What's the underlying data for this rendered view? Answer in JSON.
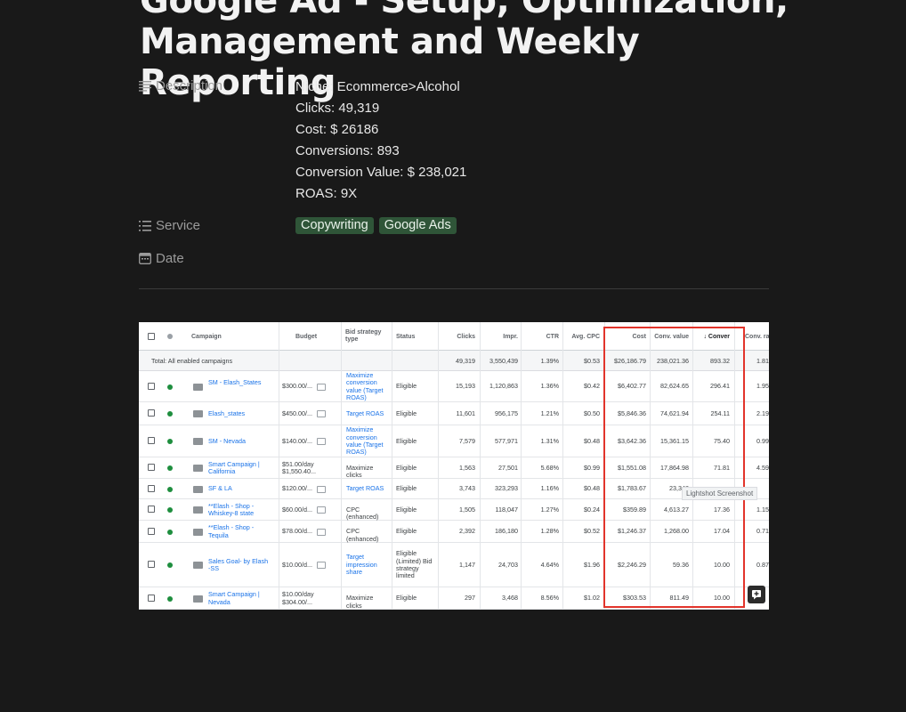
{
  "title": "Google Ad - Setup, Optimization, Management and Weekly Reporting",
  "properties": {
    "description_label": "Description",
    "description_lines": [
      "Niche: Ecommerce>Alcohol",
      "Clicks: 49,319",
      "Cost: $ 26186",
      "Conversions: 893",
      "Conversion Value: $ 238,021",
      "ROAS: 9X"
    ],
    "service_label": "Service",
    "service_tags": [
      "Copywriting",
      "Google Ads"
    ],
    "date_label": "Date",
    "tag_color": "#2f5538"
  },
  "screenshot": {
    "headers": [
      "Campaign",
      "Budget",
      "Bid strategy type",
      "Status",
      "Clicks",
      "Impr.",
      "CTR",
      "Avg. CPC",
      "Cost",
      "Conv. value",
      "↓ Conver",
      "Conv. rat"
    ],
    "total_row": {
      "label": "Total: All enabled campaigns",
      "clicks": "49,319",
      "impr": "3,550,439",
      "ctr": "1.39%",
      "cpc": "$0.53",
      "cost": "$26,186.79",
      "conv_value": "238,021.36",
      "conv": "893.32",
      "conv_rate": "1.81"
    },
    "rows": [
      {
        "campaign": "SM - Elash_States",
        "budget": "$300.00/...",
        "bid": "Maximize conversion value (Target ROAS)",
        "bid_link": true,
        "status": "Eligible",
        "clicks": "15,193",
        "impr": "1,120,863",
        "ctr": "1.36%",
        "cpc": "$0.42",
        "cost": "$6,402.77",
        "conv_value": "82,624.65",
        "conv": "296.41",
        "conv_rate": "1.95"
      },
      {
        "campaign": "Elash_states",
        "budget": "$450.00/...",
        "bid": "Target ROAS",
        "bid_link": true,
        "status": "Eligible",
        "clicks": "11,601",
        "impr": "956,175",
        "ctr": "1.21%",
        "cpc": "$0.50",
        "cost": "$5,846.36",
        "conv_value": "74,621.94",
        "conv": "254.11",
        "conv_rate": "2.19"
      },
      {
        "campaign": "SM - Nevada",
        "budget": "$140.00/...",
        "bid": "Maximize conversion value (Target ROAS)",
        "bid_link": true,
        "status": "Eligible",
        "clicks": "7,579",
        "impr": "577,971",
        "ctr": "1.31%",
        "cpc": "$0.48",
        "cost": "$3,642.36",
        "conv_value": "15,361.15",
        "conv": "75.40",
        "conv_rate": "0.99"
      },
      {
        "campaign": "Smart Campaign | California",
        "budget": "$51.00/day $1,550.40...",
        "bid": "Maximize clicks",
        "bid_link": false,
        "status": "Eligible",
        "clicks": "1,563",
        "impr": "27,501",
        "ctr": "5.68%",
        "cpc": "$0.99",
        "cost": "$1,551.08",
        "conv_value": "17,864.98",
        "conv": "71.81",
        "conv_rate": "4.59"
      },
      {
        "campaign": "SF & LA",
        "budget": "$120.00/...",
        "bid": "Target ROAS",
        "bid_link": true,
        "status": "Eligible",
        "clicks": "3,743",
        "impr": "323,293",
        "ctr": "1.16%",
        "cpc": "$0.48",
        "cost": "$1,783.67",
        "conv_value": "23,348",
        "conv": "",
        "conv_rate": ""
      },
      {
        "campaign": "**Elash - Shop - Whiskey-8 state",
        "budget": "$60.00/d...",
        "bid": "CPC (enhanced)",
        "bid_link": false,
        "status": "Eligible",
        "clicks": "1,505",
        "impr": "118,047",
        "ctr": "1.27%",
        "cpc": "$0.24",
        "cost": "$359.89",
        "conv_value": "4,613.27",
        "conv": "17.36",
        "conv_rate": "1.15"
      },
      {
        "campaign": "**Elash - Shop - Tequila",
        "budget": "$78.00/d...",
        "bid": "CPC (enhanced)",
        "bid_link": false,
        "status": "Eligible",
        "clicks": "2,392",
        "impr": "186,180",
        "ctr": "1.28%",
        "cpc": "$0.52",
        "cost": "$1,246.37",
        "conv_value": "1,268.00",
        "conv": "17.04",
        "conv_rate": "0.71"
      },
      {
        "campaign": "Sales Goal- by Elash -SS",
        "budget": "$10.00/d...",
        "bid": "Target impression share",
        "bid_link": true,
        "status": "Eligible (Limited) Bid strategy limited",
        "clicks": "1,147",
        "impr": "24,703",
        "ctr": "4.64%",
        "cpc": "$1.96",
        "cost": "$2,246.29",
        "conv_value": "59.36",
        "conv": "10.00",
        "conv_rate": "0.87"
      },
      {
        "campaign": "Smart Campaign | Nevada",
        "budget": "$10.00/day $304.00/...",
        "bid": "Maximize clicks",
        "bid_link": false,
        "status": "Eligible",
        "clicks": "297",
        "impr": "3,468",
        "ctr": "8.56%",
        "cpc": "$1.02",
        "cost": "$303.53",
        "conv_value": "811.49",
        "conv": "10.00",
        "conv_rate": ""
      }
    ],
    "tooltip": "Lightshot Screenshot",
    "highlight_color": "#e2342b"
  }
}
